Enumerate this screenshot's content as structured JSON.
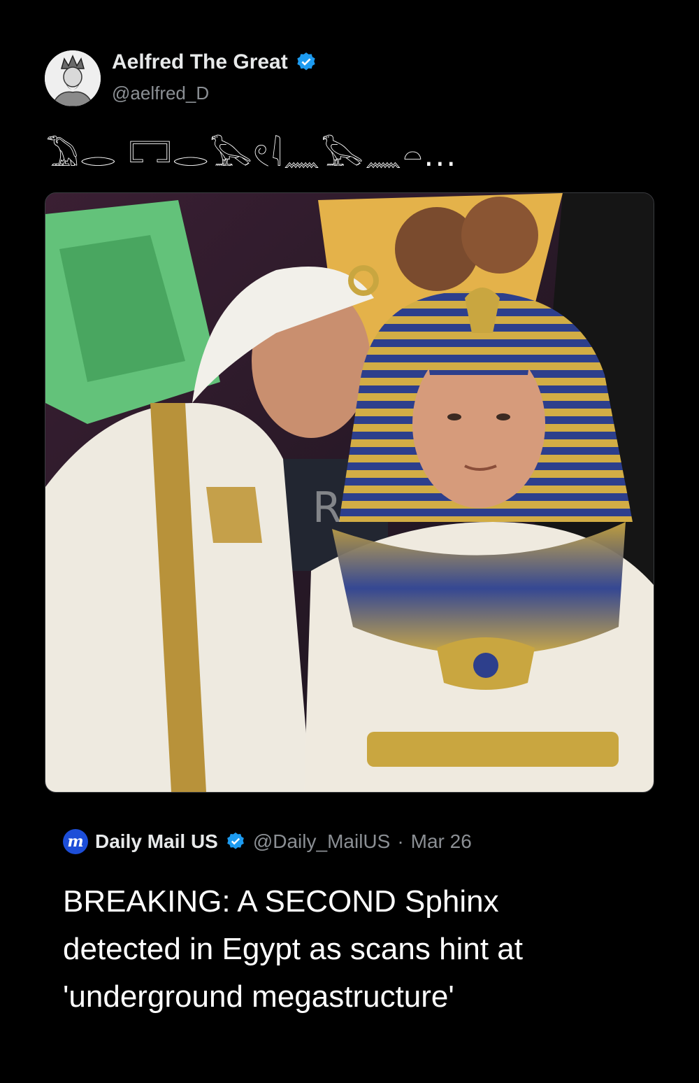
{
  "author": {
    "display_name": "Aelfred The Great",
    "handle": "@aelfred_D"
  },
  "tweet": {
    "text": "𓅐𓂋 𓉐𓂋𓅂𓏲𓇋𓈖𓅂𓈖𓏏..."
  },
  "media": {
    "sign_text": "R"
  },
  "quoted": {
    "display_name": "Daily Mail US",
    "logo_letter": "m",
    "handle": "@Daily_MailUS",
    "separator": "·",
    "date": "Mar 26",
    "lines": [
      "BREAKING: A SECOND Sphinx",
      "detected in Egypt as scans hint at",
      "'underground megastructure'"
    ]
  },
  "colors": {
    "background": "#000000",
    "verified": "#1d9bf0",
    "secondary_text": "#8b8f94"
  },
  "icons": {
    "verified": "verified-badge-icon",
    "logo": "daily-mail-logo"
  }
}
